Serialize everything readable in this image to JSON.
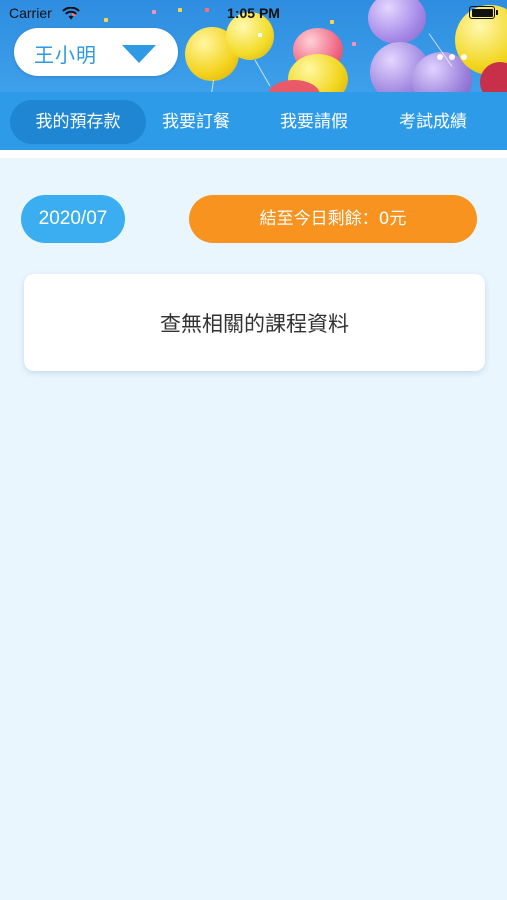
{
  "status_bar": {
    "carrier": "Carrier",
    "time": "1:05 PM"
  },
  "user_selector": {
    "name": "王小明"
  },
  "tabs": [
    {
      "label": "我的預存款",
      "active": true
    },
    {
      "label": "我要訂餐",
      "active": false
    },
    {
      "label": "我要請假",
      "active": false
    },
    {
      "label": "考試成績",
      "active": false
    }
  ],
  "summary": {
    "month": "2020/07",
    "balance": "結至今日剩餘：0元"
  },
  "records": {
    "empty_message": "查無相關的課程資料"
  },
  "colors": {
    "accent": "#2e9be8",
    "orange": "#f7931e",
    "background": "#eaf6fd"
  }
}
